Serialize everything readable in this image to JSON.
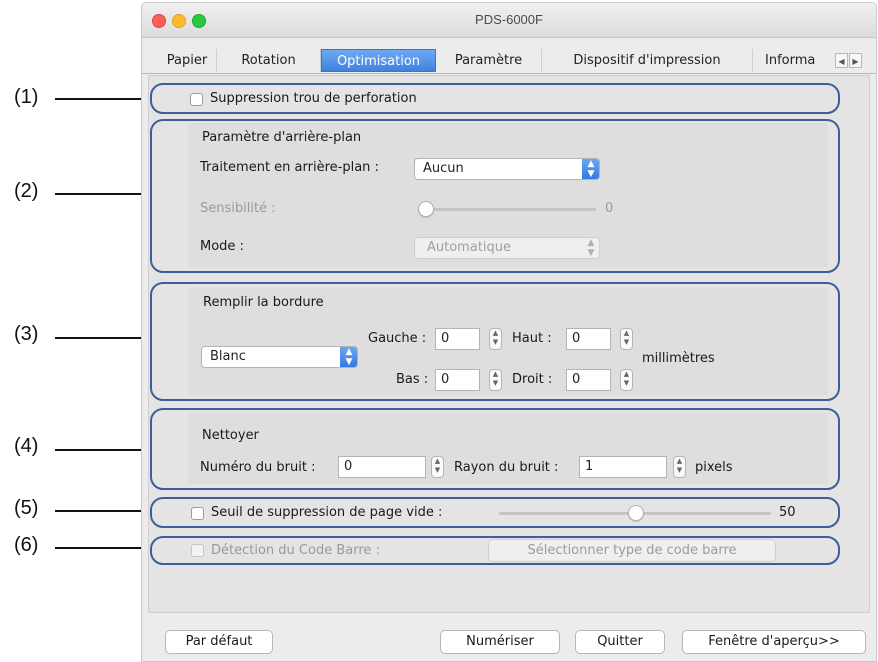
{
  "window": {
    "title": "PDS-6000F"
  },
  "tabs": [
    "Papier",
    "Rotation",
    "Optimisation",
    "Paramètre",
    "Dispositif d'impression",
    "Informa"
  ],
  "tab_scroll": {
    "left": "◀",
    "right": "▶"
  },
  "callouts": [
    "(1)",
    "(2)",
    "(3)",
    "(4)",
    "(5)",
    "(6)"
  ],
  "section1": {
    "punch_hole_label": "Suppression trou de perforation"
  },
  "section2": {
    "title": "Paramètre d'arrière-plan",
    "treatment_label": "Traitement en arrière-plan :",
    "treatment_value": "Aucun",
    "sensitivity_label": "Sensibilité :",
    "sensitivity_value": "0",
    "mode_label": "Mode :",
    "mode_value": "Automatique"
  },
  "section3": {
    "title": "Remplir la bordure",
    "color_value": "Blanc",
    "left_label": "Gauche :",
    "left_value": "0",
    "top_label": "Haut :",
    "top_value": "0",
    "bottom_label": "Bas :",
    "bottom_value": "0",
    "right_label": "Droit :",
    "right_value": "0",
    "unit": "millimètres"
  },
  "section4": {
    "title": "Nettoyer",
    "noise_number_label": "Numéro du bruit :",
    "noise_number_value": "0",
    "noise_radius_label": "Rayon du bruit :",
    "noise_radius_value": "1",
    "unit": "pixels"
  },
  "section5": {
    "blank_page_label": "Seuil de suppression de page vide :",
    "blank_page_value": "50"
  },
  "section6": {
    "barcode_label": "Détection du Code Barre :",
    "barcode_button": "Sélectionner type de code barre"
  },
  "footer": {
    "default_button": "Par défaut",
    "scan_button": "Numériser",
    "quit_button": "Quitter",
    "preview_button": "Fenêtre d'aperçu>>"
  }
}
